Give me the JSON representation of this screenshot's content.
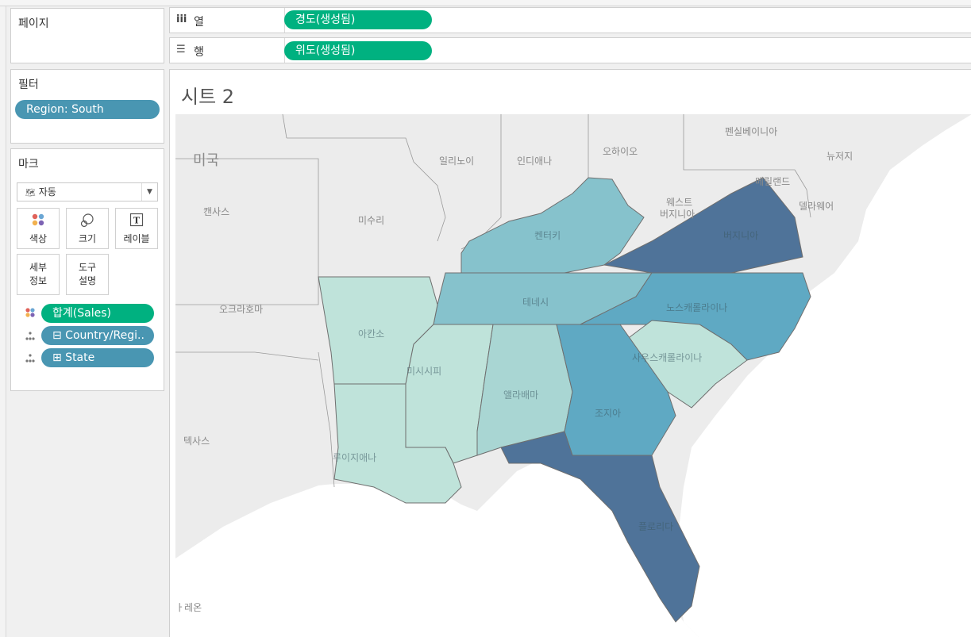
{
  "shelves": {
    "columns": {
      "label": "열",
      "pill": "경도(생성됨)"
    },
    "rows": {
      "label": "행",
      "pill": "위도(생성됨)"
    }
  },
  "pages": {
    "title": "페이지"
  },
  "filters": {
    "title": "필터",
    "items": [
      "Region: South"
    ]
  },
  "marks": {
    "title": "마크",
    "type_dropdown": "자동",
    "buttons": {
      "color": "색상",
      "size": "크기",
      "label": "레이블",
      "detail_line1": "세부",
      "detail_line2": "정보",
      "tooltip_line1": "도구",
      "tooltip_line2": "설명"
    },
    "fields": [
      {
        "name": "합계(Sales)",
        "role": "color",
        "color": "#00b180"
      },
      {
        "name": "⊟ Country/Regi..",
        "role": "detail",
        "color": "#4996b2"
      },
      {
        "name": "⊞ State",
        "role": "detail",
        "color": "#4996b2"
      }
    ]
  },
  "sheet": {
    "title": "시트 2"
  },
  "map": {
    "country_label": "미국",
    "background_labels": {
      "pennsylvania": "펜실베이니아",
      "new_jersey": "뉴저지",
      "ohio": "오하이오",
      "indiana": "인디애나",
      "illinois": "일리노이",
      "maryland": "메릴랜드",
      "delaware": "델라웨어",
      "west_virginia_1": "웨스트",
      "west_virginia_2": "버지니아",
      "kansas": "캔사스",
      "missouri": "미수리",
      "oklahoma": "오크라호마",
      "texas": "텍사스",
      "mexico_partial": "ㅏ레온"
    },
    "state_labels": {
      "virginia": "버지니아",
      "kentucky": "켄터키",
      "tennessee": "테네시",
      "north_carolina": "노스캐롤라이나",
      "south_carolina": "사우스캐롤라이나",
      "arkansas": "아칸소",
      "mississippi": "미시시피",
      "alabama": "앨라배마",
      "georgia": "조지아",
      "louisiana": "루이지애나",
      "florida": "플로리다"
    },
    "colors": {
      "lowest": "#bfe3da",
      "low": "#a9d6d3",
      "mid": "#86c2cc",
      "high": "#5fa9c3",
      "higher": "#4a8eae",
      "highest": "#4f7399",
      "land": "#ececec",
      "water": "#ffffff"
    }
  }
}
